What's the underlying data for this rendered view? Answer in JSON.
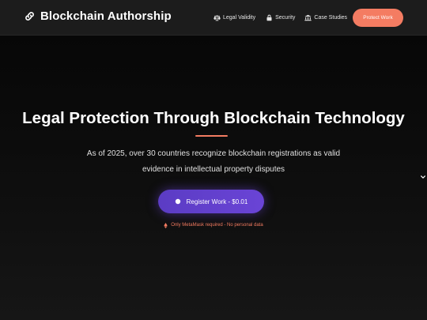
{
  "header": {
    "brand": {
      "title": "Blockchain Authorship",
      "icon": "link-icon"
    },
    "nav": [
      {
        "label": "Legal Validity",
        "icon": "scale-icon"
      },
      {
        "label": "Security",
        "icon": "lock-icon"
      },
      {
        "label": "Case Studies",
        "icon": "institution-icon"
      }
    ],
    "cta_label": "Protect Work"
  },
  "hero": {
    "title": "Legal Protection Through Blockchain Technology",
    "subtitle": "As of 2025, over 30 countries recognize blockchain registrations as valid evidence in intellectual property disputes",
    "register_label": "Register Work - $0.01",
    "register_icon": "circle-icon",
    "note": "Only MetaMask required - No personal data",
    "note_icon": "ethereum-icon",
    "scroll_icon": "chevron-down-icon"
  },
  "colors": {
    "accent": "#f47c62",
    "button_purple": "#6a44d6",
    "navbar_bg": "#1c1c1c",
    "page_bg": "#0b0b0b"
  }
}
